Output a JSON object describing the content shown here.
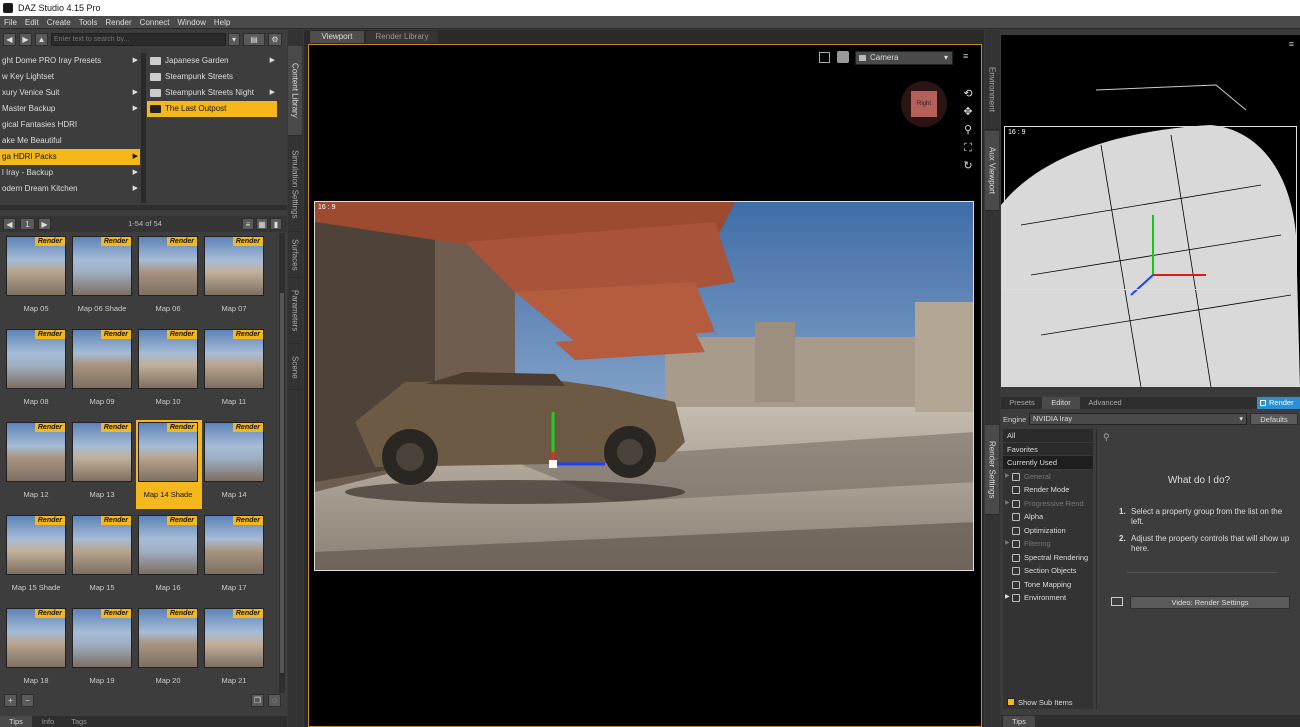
{
  "app": {
    "title": "DAZ Studio 4.15 Pro"
  },
  "menu": [
    "File",
    "Edit",
    "Create",
    "Tools",
    "Render",
    "Connect",
    "Window",
    "Help"
  ],
  "content_library": {
    "search_placeholder": "Enter text to search by...",
    "tree_left": [
      "ght Dome PRO Iray Presets",
      "w Key Lightset",
      "xury Venice Suit",
      "Master Backup",
      "gical Fantasies HDRI",
      "ake Me Beautiful",
      "ga HDRI Packs",
      "l Iray - Backup",
      "odern Dream Kitchen"
    ],
    "tree_right": [
      "Japanese Garden",
      "Steampunk Streets",
      "Steampunk Streets Night",
      "The Last Outpost"
    ],
    "page": "1",
    "range": "1-54 of 54",
    "badge": "Render",
    "thumbs": [
      "Map 05",
      "Map 06 Shade",
      "Map 06",
      "Map 07",
      "Map 08",
      "Map 09",
      "Map 10",
      "Map 11",
      "Map 12",
      "Map 13",
      "Map 14 Shade",
      "Map 14",
      "Map 15 Shade",
      "Map 15",
      "Map 16",
      "Map 17",
      "Map 18",
      "Map 19",
      "Map 20",
      "Map 21"
    ],
    "bottom_tabs": [
      "Tips",
      "Info",
      "Tags"
    ]
  },
  "side_tabs": [
    "Content Library",
    "Simulation Settings",
    "Surfaces",
    "Parameters",
    "Scene"
  ],
  "viewport": {
    "tabs": [
      "Viewport",
      "Render Library"
    ],
    "camera": "Camera",
    "aspect": "16 : 9",
    "cube_label": "Right"
  },
  "right_side_tabs": [
    "Environment",
    "Aux Viewport",
    "Render Settings"
  ],
  "aux": {
    "aspect": "16 : 9"
  },
  "render": {
    "tabs": [
      "Presets",
      "Editor",
      "Advanced"
    ],
    "render_button": "Render",
    "engine_label": "Engine :",
    "engine_value": "NVIDIA Iray",
    "defaults": "Defaults",
    "cats": [
      "All",
      "Favorites",
      "Currently Used"
    ],
    "props": [
      "General",
      "Render Mode",
      "Progressive Rend",
      "Alpha",
      "Optimization",
      "Filtering",
      "Spectral Rendering",
      "Section Objects",
      "Tone Mapping",
      "Environment"
    ],
    "help_title": "What do I do?",
    "step1_num": "1.",
    "step1": "Select a property group from the list on the left.",
    "step2_num": "2.",
    "step2": "Adjust the property controls that will show up here.",
    "video": "Video: Render Settings",
    "show_sub": "Show Sub Items",
    "bottom_tab": "Tips"
  },
  "colors": {
    "accent": "#f4b81c",
    "panel": "#3d3d3d",
    "render_blue": "#2a8fd4"
  }
}
